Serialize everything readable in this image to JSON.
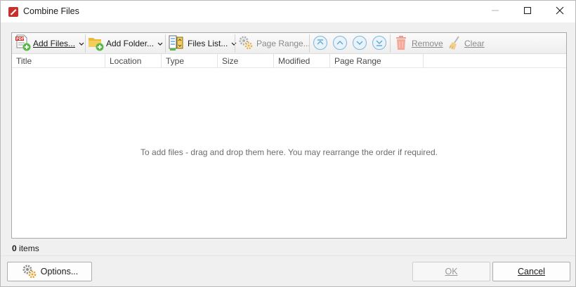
{
  "window": {
    "title": "Combine Files",
    "icon": "pdf-app-icon"
  },
  "toolbar": {
    "add_files_label": "Add Files...",
    "add_folder_label": "Add Folder...",
    "files_list_label": "Files List...",
    "page_range_label": "Page Range...",
    "remove_label": "Remove",
    "clear_label": "Clear"
  },
  "table": {
    "columns": [
      "Title",
      "Location",
      "Type",
      "Size",
      "Modified",
      "Page Range"
    ],
    "rows": []
  },
  "drop_hint": "To add files - drag and drop them here. You may rearrange the order if required.",
  "status": {
    "count": "0",
    "count_suffix": "items"
  },
  "buttons": {
    "options_label": "Options...",
    "ok_label": "OK",
    "cancel_label": "Cancel"
  },
  "colors": {
    "accent_red": "#c8302a",
    "add_green": "#5ab74a",
    "nav_blue": "#5fa8d8"
  }
}
